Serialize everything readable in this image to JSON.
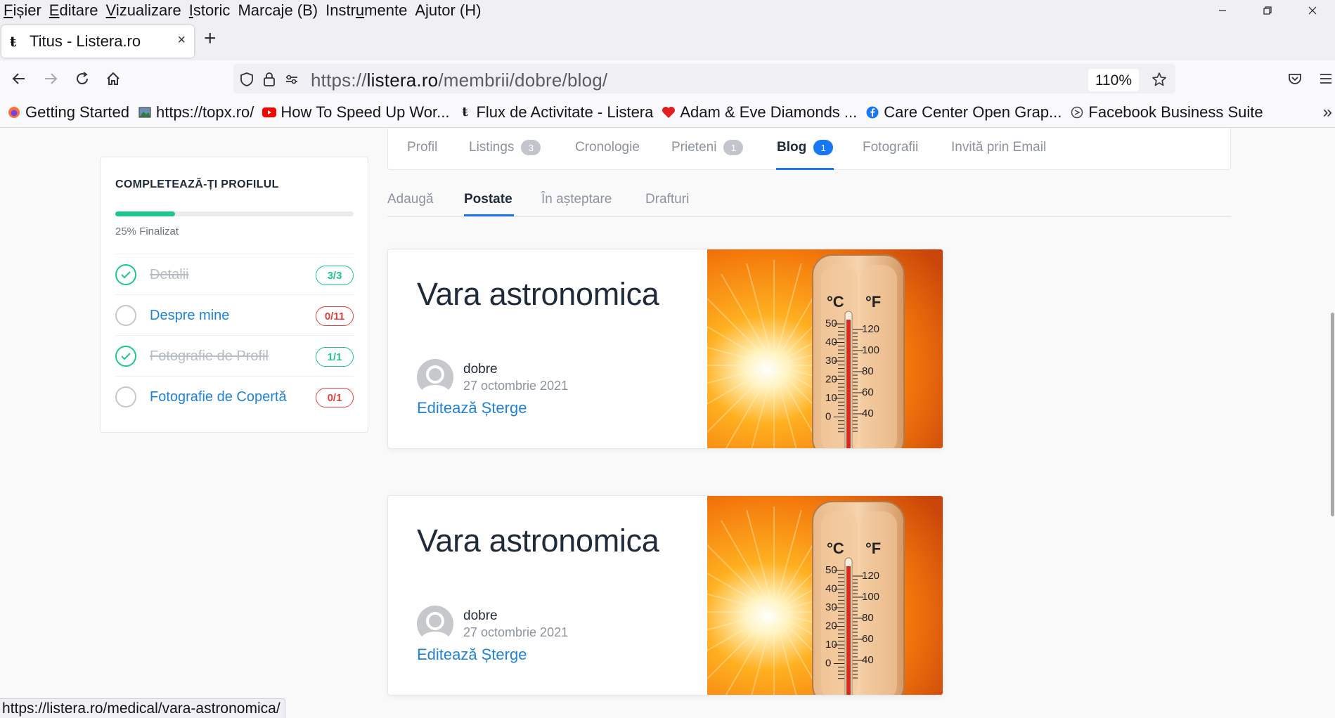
{
  "menubar": {
    "items": [
      {
        "label": "Fișier",
        "accel": "F",
        "rest": "ișier"
      },
      {
        "label": "Editare",
        "accel": "E",
        "rest": "ditare"
      },
      {
        "label": "Vizualizare",
        "accel": "V",
        "rest": "izualizare"
      },
      {
        "label": "Istoric",
        "accel": "I",
        "rest": "storic"
      },
      {
        "label": "Marcaje (B)"
      },
      {
        "label": "Instrumente",
        "pre": "Instr",
        "accel": "u",
        "rest": "mente"
      },
      {
        "label": "Ajutor (H)"
      }
    ]
  },
  "tab": {
    "favicon": "ŧ",
    "title": "Titus - Listera.ro",
    "close": "×",
    "new_tab": "+"
  },
  "urlbar": {
    "scheme": "https://",
    "domain": "listera.ro",
    "path": "/membrii/dobre/blog/",
    "zoom": "110%"
  },
  "bookmarks": [
    {
      "label": "Getting Started",
      "icon": "firefox-icon",
      "color": "#e66000"
    },
    {
      "label": "https://topx.ro/",
      "icon": "image-icon",
      "color": "#2e7d32"
    },
    {
      "label": "How To Speed Up Wor...",
      "icon": "youtube-icon",
      "color": "#ff0000"
    },
    {
      "label": "Flux de Activitate - Listera",
      "icon": "listera-icon",
      "color": "#111111"
    },
    {
      "label": "Adam & Eve Diamonds ...",
      "icon": "heart-icon",
      "color": "#e02020"
    },
    {
      "label": "Care Center Open Grap...",
      "icon": "facebook-icon",
      "color": "#1877f2"
    },
    {
      "label": "Facebook Business Suite",
      "icon": "business-suite-icon",
      "color": "#444444"
    }
  ],
  "profile_card": {
    "title": "COMPLETEAZĂ-ȚI PROFILUL",
    "progress": 0.25,
    "caption": "25% Finalizat",
    "items": [
      {
        "label": "Detalii",
        "count": "3/3",
        "done": true
      },
      {
        "label": "Despre mine",
        "count": "0/11",
        "done": false
      },
      {
        "label": "Fotografie de Profil",
        "count": "1/1",
        "done": true
      },
      {
        "label": "Fotografie de Copertă",
        "count": "0/1",
        "done": false
      }
    ]
  },
  "profile_tabs": [
    {
      "label": "Profil"
    },
    {
      "label": "Listings",
      "count": "3"
    },
    {
      "label": "Cronologie"
    },
    {
      "label": "Prieteni",
      "count": "1"
    },
    {
      "label": "Blog",
      "count": "1",
      "active": true
    },
    {
      "label": "Fotografii"
    },
    {
      "label": "Invită prin Email"
    }
  ],
  "blog_subtabs": [
    {
      "label": "Adaugă"
    },
    {
      "label": "Postate",
      "active": true
    },
    {
      "label": "În așteptare"
    },
    {
      "label": "Drafturi"
    }
  ],
  "posts": [
    {
      "title": "Vara astronomica",
      "author": "dobre",
      "date": "27 octombrie 2021",
      "edit_label": "Editează",
      "delete_label": "Șterge"
    },
    {
      "title": "Vara astronomica",
      "author": "dobre",
      "date": "27 octombrie 2021",
      "edit_label": "Editează",
      "delete_label": "Șterge"
    }
  ],
  "thermometer": {
    "celsius_unit": "°C",
    "fahrenheit_unit": "°F",
    "celsius_ticks": [
      "50",
      "40",
      "30",
      "20",
      "10",
      "0"
    ],
    "fahrenheit_ticks": [
      "120",
      "100",
      "80",
      "60",
      "40"
    ]
  },
  "statusbar": {
    "url": "https://listera.ro/medical/vara-astronomica/"
  },
  "colors": {
    "accent": "#1877f2",
    "link": "#2083d8",
    "success": "#1dc88b",
    "danger": "#e0413c"
  }
}
